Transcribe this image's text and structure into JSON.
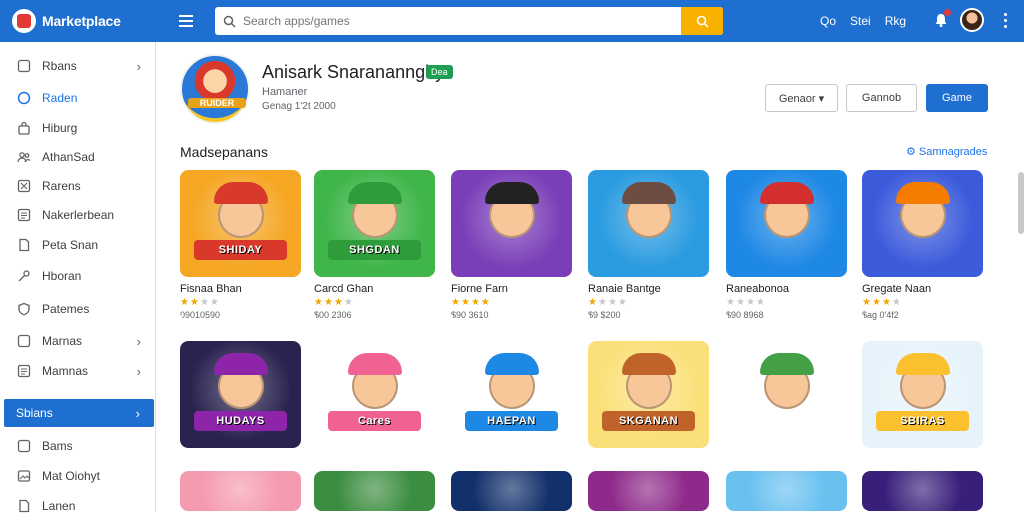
{
  "header": {
    "brand": "Marketplace",
    "search_placeholder": "Search apps/games",
    "links": [
      "Qo",
      "Stei",
      "Rkg"
    ]
  },
  "sidebar": {
    "items": [
      {
        "label": "Rbans",
        "icon": "square-icon",
        "chevron": "›"
      },
      {
        "label": "Raden",
        "icon": "circle-icon",
        "chevron": ""
      },
      {
        "label": "Hiburg",
        "icon": "bag-icon",
        "chevron": ""
      },
      {
        "label": "AthanSad",
        "icon": "people-icon",
        "chevron": ""
      },
      {
        "label": "Rarens",
        "icon": "grid-icon",
        "chevron": ""
      },
      {
        "label": "Nakerlerbean",
        "icon": "list-icon",
        "chevron": ""
      },
      {
        "label": "Peta Snan",
        "icon": "doc-icon",
        "chevron": ""
      },
      {
        "label": "Hboran",
        "icon": "key-icon",
        "chevron": ""
      },
      {
        "label": "Patemes",
        "icon": "shield-icon",
        "chevron": ""
      },
      {
        "label": "Marnas",
        "icon": "square-icon",
        "chevron": "›"
      },
      {
        "label": "Mamnas",
        "icon": "list-icon",
        "chevron": "›"
      },
      {
        "label": "Sbians",
        "icon": "",
        "chevron": "›"
      },
      {
        "label": "Bams",
        "icon": "square-icon",
        "chevron": ""
      },
      {
        "label": "Mat Oiohyt",
        "icon": "image-icon",
        "chevron": ""
      },
      {
        "label": "Lanen",
        "icon": "doc-icon",
        "chevron": ""
      }
    ]
  },
  "app": {
    "title": "Anisark Snaranannghy",
    "badge": "Dea",
    "developer": "Hamaner",
    "meta": "Genag 1'2t 2000",
    "logo_text": "RUIDER",
    "buttons": [
      "Genaor ▾",
      "Gannob",
      "Game"
    ]
  },
  "section": {
    "title": "Madsepanans",
    "link": "Samnagrades"
  },
  "tiles": [
    {
      "name": "Fisnaa Bhan",
      "rating": 2,
      "price": "09010590",
      "banner": "SHIDAY",
      "bg": "#f5a623",
      "hat": "#d8392b"
    },
    {
      "name": "Carcd Ghan",
      "rating": 3,
      "price": "$00 2306",
      "banner": "SHGDAN",
      "bg": "#3fb54a",
      "hat": "#2e9c3a"
    },
    {
      "name": "Fiorne Farn",
      "rating": 4,
      "price": "$90 3610",
      "banner": "",
      "bg": "#7a3fb8",
      "hat": "#222222"
    },
    {
      "name": "Ranaie Bantge",
      "rating": 1,
      "price": "$9 $200",
      "banner": "",
      "bg": "#2a9be0",
      "hat": "#6d4c41"
    },
    {
      "name": "Raneabonoa",
      "rating": 0,
      "price": "$90 8968",
      "banner": "",
      "bg": "#1e88e5",
      "hat": "#d32f2f"
    },
    {
      "name": "Gregate Naan",
      "rating": 3,
      "price": "$ag 0'4f2",
      "banner": "",
      "bg": "#3b5bdb",
      "hat": "#f57c00"
    },
    {
      "name": "",
      "rating": 0,
      "price": "",
      "banner": "HUDAYS",
      "bg": "#2a2350",
      "hat": "#8e24aa"
    },
    {
      "name": "",
      "rating": 0,
      "price": "",
      "banner": "Cares",
      "bg": "#ffffff",
      "hat": "#f06292"
    },
    {
      "name": "",
      "rating": 0,
      "price": "",
      "banner": "HAEPAN",
      "bg": "#ffffff",
      "hat": "#1e88e5"
    },
    {
      "name": "",
      "rating": 0,
      "price": "",
      "banner": "SKGANAN",
      "bg": "#fbe07a",
      "hat": "#c0632a"
    },
    {
      "name": "",
      "rating": 0,
      "price": "",
      "banner": "",
      "bg": "#ffffff",
      "hat": "#43a047"
    },
    {
      "name": "",
      "rating": 0,
      "price": "",
      "banner": "SBIRAS",
      "bg": "#e7f3fb",
      "hat": "#fbc02d"
    },
    {
      "name": "",
      "rating": 0,
      "price": "",
      "banner": "",
      "bg": "#f59bb0",
      "hat": "#43a047"
    },
    {
      "name": "",
      "rating": 0,
      "price": "",
      "banner": "",
      "bg": "#3b8d3f",
      "hat": "#fbc02d"
    },
    {
      "name": "",
      "rating": 0,
      "price": "",
      "banner": "",
      "bg": "#12306b",
      "hat": "#ff8f00"
    },
    {
      "name": "",
      "rating": 0,
      "price": "",
      "banner": "",
      "bg": "#8e2a8a",
      "hat": "#ff6f00"
    },
    {
      "name": "",
      "rating": 0,
      "price": "",
      "banner": "",
      "bg": "#6ac1f0",
      "hat": "#2e7d32"
    },
    {
      "name": "",
      "rating": 0,
      "price": "",
      "banner": "",
      "bg": "#3a1f7a",
      "hat": "#ff7043"
    }
  ]
}
